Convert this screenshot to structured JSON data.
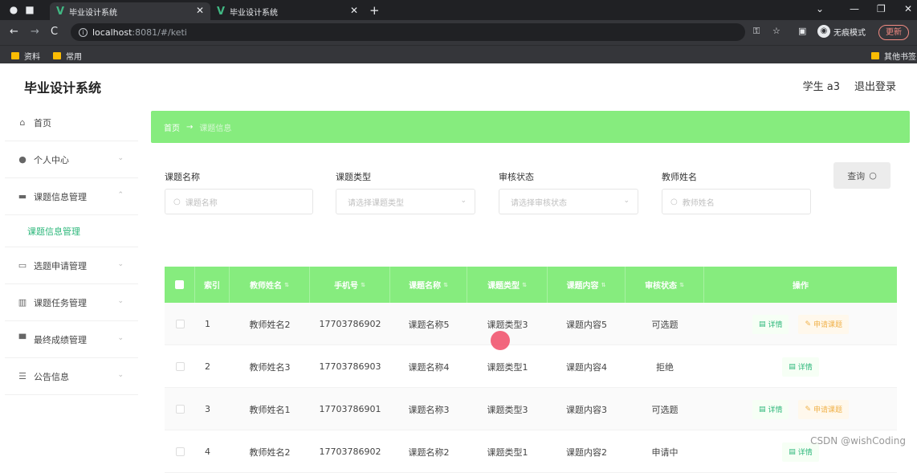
{
  "browser": {
    "tabs": [
      {
        "title": "毕业设计系统",
        "active": true
      },
      {
        "title": "毕业设计系统",
        "active": false
      }
    ],
    "url_host": "localhost",
    "url_path": ":8081/#/keti",
    "incognito_label": "无痕模式",
    "update_label": "更新",
    "bookmarks": [
      "资料",
      "常用"
    ],
    "other_bookmarks": "其他书签"
  },
  "app": {
    "title": "毕业设计系统",
    "user": "学生 a3",
    "logout": "退出登录"
  },
  "sidebar": {
    "items": [
      {
        "label": "首页",
        "icon": "home-icon"
      },
      {
        "label": "个人中心",
        "icon": "user-icon"
      },
      {
        "label": "课题信息管理",
        "icon": "folder-icon"
      },
      {
        "label": "选题申请管理",
        "icon": "briefcase-icon"
      },
      {
        "label": "课题任务管理",
        "icon": "chart-icon"
      },
      {
        "label": "最终成绩管理",
        "icon": "monitor-icon"
      },
      {
        "label": "公告信息",
        "icon": "sliders-icon"
      }
    ],
    "active_sub": "课题信息管理"
  },
  "breadcrumb": {
    "home": "首页",
    "current": "课题信息"
  },
  "filters": {
    "topic_name": {
      "label": "课题名称",
      "placeholder": "课题名称"
    },
    "topic_type": {
      "label": "课题类型",
      "placeholder": "请选择课题类型"
    },
    "review_status": {
      "label": "审核状态",
      "placeholder": "请选择审核状态"
    },
    "teacher_name": {
      "label": "教师姓名",
      "placeholder": "教师姓名"
    },
    "query_label": "查询"
  },
  "table": {
    "headers": [
      "索引",
      "教师姓名",
      "手机号",
      "课题名称",
      "课题类型",
      "课题内容",
      "审核状态",
      "操作"
    ],
    "detail_label": "详情",
    "apply_label": "申请课题",
    "rows": [
      {
        "idx": "1",
        "teacher": "教师姓名2",
        "phone": "17703786902",
        "name": "课题名称5",
        "type": "课题类型3",
        "content": "课题内容5",
        "status": "可选题",
        "can_apply": true
      },
      {
        "idx": "2",
        "teacher": "教师姓名3",
        "phone": "17703786903",
        "name": "课题名称4",
        "type": "课题类型1",
        "content": "课题内容4",
        "status": "拒绝",
        "can_apply": false
      },
      {
        "idx": "3",
        "teacher": "教师姓名1",
        "phone": "17703786901",
        "name": "课题名称3",
        "type": "课题类型3",
        "content": "课题内容3",
        "status": "可选题",
        "can_apply": true
      },
      {
        "idx": "4",
        "teacher": "教师姓名2",
        "phone": "17703786902",
        "name": "课题名称2",
        "type": "课题类型1",
        "content": "课题内容2",
        "status": "申请中",
        "can_apply": false
      }
    ]
  },
  "watermark": "CSDN @wishCoding",
  "colors": {
    "accent_green": "#86ec7e",
    "text_green": "#2db77b",
    "apply_orange": "#f0b24b"
  }
}
